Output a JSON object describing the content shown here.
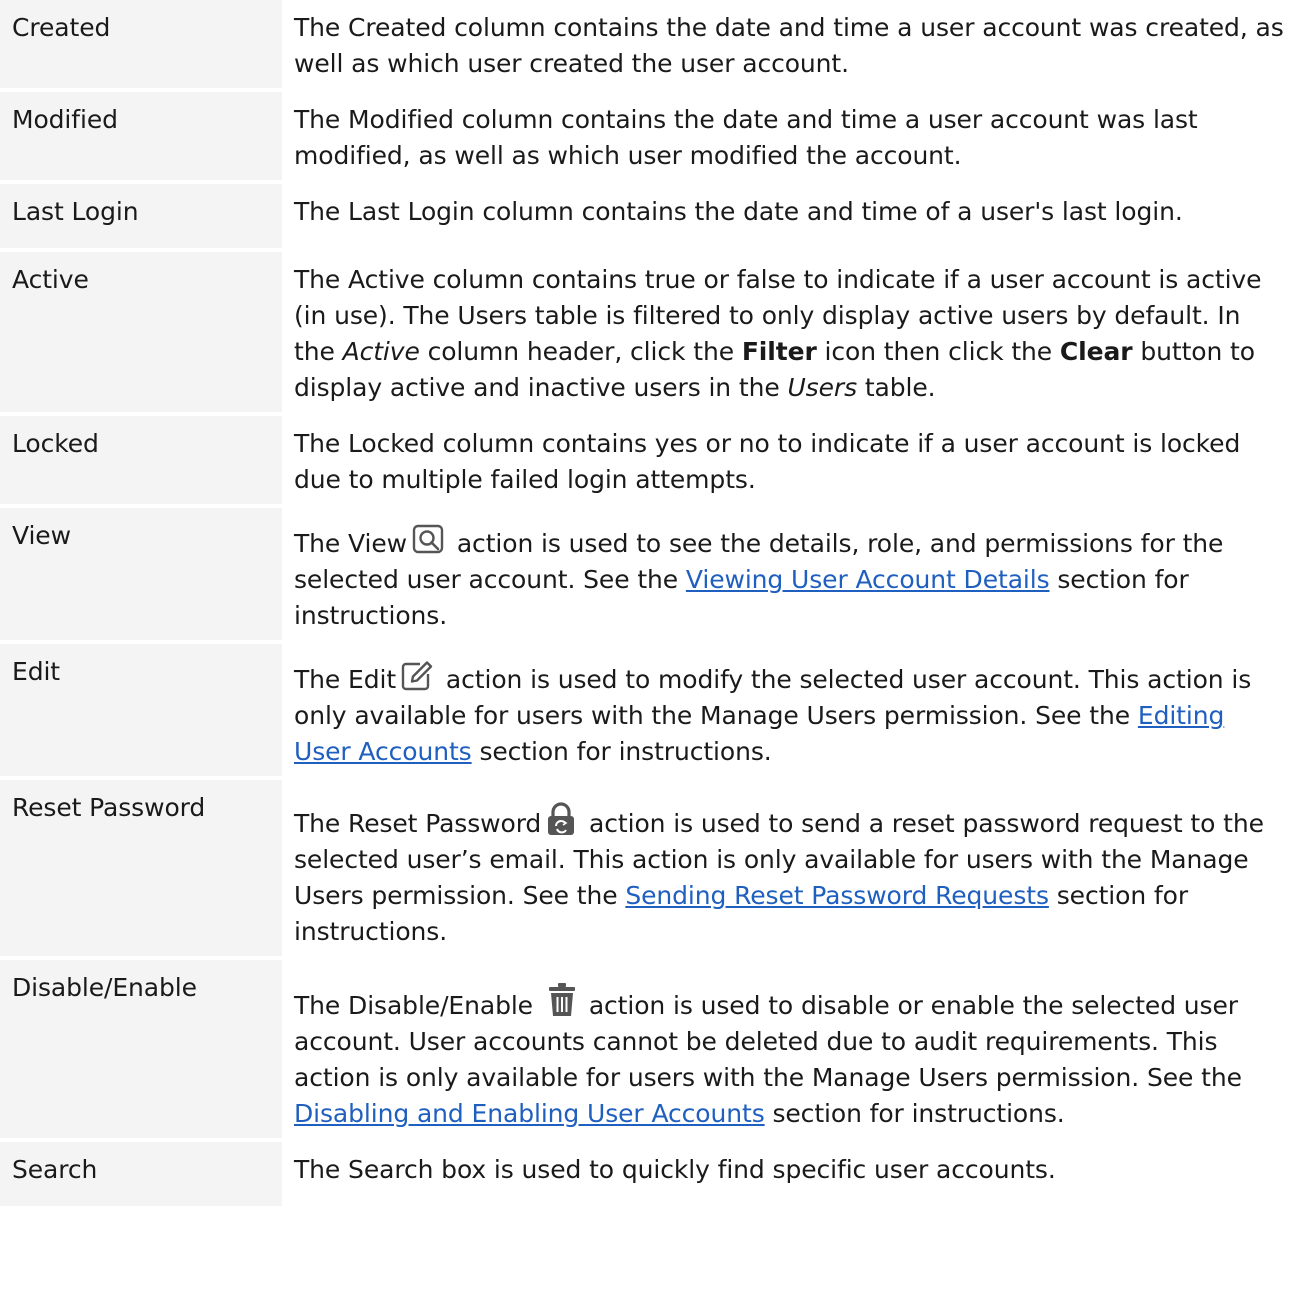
{
  "rows": [
    {
      "term": "Created",
      "desc": "The Created column contains the date and time a user account was created, as well as which user created the user account."
    },
    {
      "term": "Modified",
      "desc": "The Modified column contains the date and time a user account was last modified, as well as which user modified the account."
    },
    {
      "term": "Last Login",
      "desc": "The Last Login column contains the date and time of a user's last login."
    },
    {
      "term": "Active",
      "desc_p1": "The Active column contains true or false to indicate if a user account is active (in use). The Users table is filtered to only display active users by default. In the ",
      "desc_i1": "Active",
      "desc_p2": " column header, click the ",
      "desc_b1": "Filter",
      "desc_p3": " icon then click the ",
      "desc_b2": "Clear",
      "desc_p4": " button to display active and inactive users in the ",
      "desc_i2": "Users",
      "desc_p5": " table."
    },
    {
      "term": "Locked",
      "desc": "The Locked column contains yes or no to indicate if a user account is locked due to multiple failed login attempts."
    },
    {
      "term": "View",
      "desc_a": "The View",
      "icon": "view-magnifier-icon",
      "desc_b": " action is used to see the details, role, and permissions for the selected user account. See the ",
      "link": "Viewing User Account Details",
      "desc_c": " section for instructions."
    },
    {
      "term": "Edit",
      "desc_a": "The Edit",
      "icon": "edit-pencil-icon",
      "desc_b": " action is used to modify the selected user account. This action is only available for users with the Manage Users permission. See the ",
      "link": "Editing User Accounts",
      "desc_c": " section for instructions."
    },
    {
      "term": "Reset Password",
      "desc_a": "The Reset Password",
      "icon": "reset-lock-icon",
      "desc_b": " action is used to send a reset password request to the selected user’s email. This action is only available for users with the Manage Users permission. See the ",
      "link": "Sending Reset Password Requests",
      "desc_c": " section for instructions."
    },
    {
      "term": "Disable/Enable",
      "desc_a": "The Disable/Enable",
      "icon": "trash-icon",
      "desc_b": " action is used to disable or enable the selected user account. User accounts cannot be deleted due to audit requirements. This action is only available for users with the Manage Users permission. See the ",
      "link": "Disabling and Enabling User Accounts",
      "desc_c": " section for instructions."
    },
    {
      "term": "Search",
      "desc": "The Search box is used to quickly find specific user accounts."
    }
  ]
}
